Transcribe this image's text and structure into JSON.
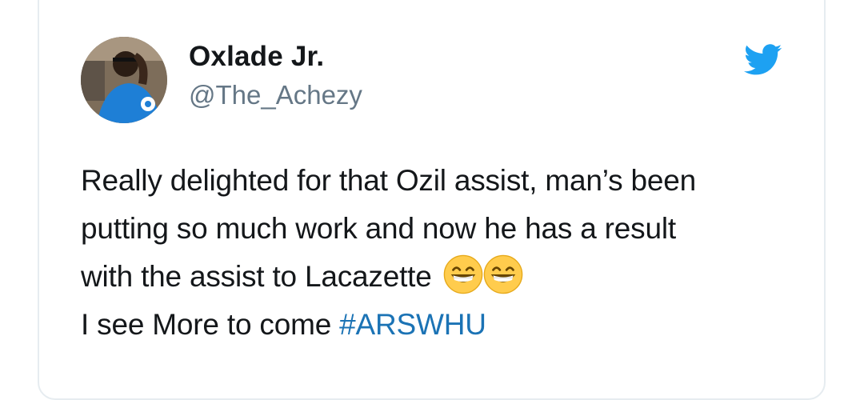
{
  "tweet": {
    "author": {
      "display_name": "Oxlade Jr.",
      "handle": "@The_Achezy"
    },
    "brand_icon": "twitter-bird-icon",
    "accent_color": "#1da1f2",
    "hashtag_color": "#1b73b5",
    "text_lines": [
      "Really delighted for that Ozil assist, man’s been",
      "putting so much work and now he has a result",
      "with the assist to Lacazette"
    ],
    "emojis": [
      "grinning-face-with-smiling-eyes-emoji",
      "grinning-face-with-smiling-eyes-emoji"
    ],
    "last_line_text": "I see More to come ",
    "hashtag": "#ARSWHU"
  }
}
